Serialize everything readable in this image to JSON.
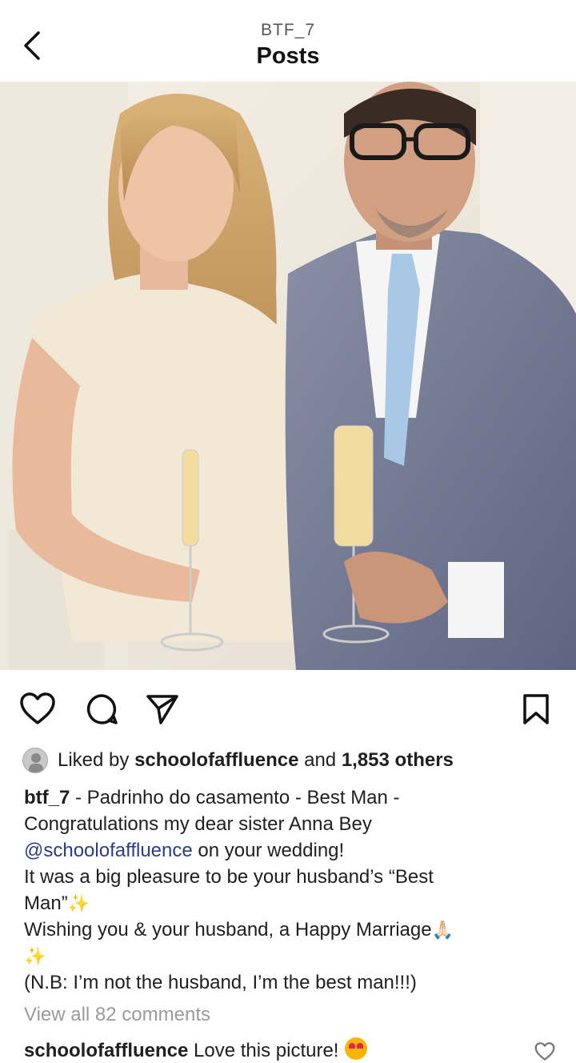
{
  "header": {
    "username": "BTF_7",
    "title": "Posts",
    "back_icon": "chevron-left-icon"
  },
  "post": {
    "image_description_icon": "photo",
    "actions": {
      "like_icon": "heart-icon",
      "comment_icon": "comment-icon",
      "share_icon": "paper-plane-icon",
      "save_icon": "bookmark-icon"
    },
    "likes": {
      "prefix": "Liked by",
      "user": "schoolofaffluence",
      "middle": "and",
      "others": "1,853 others"
    },
    "caption": {
      "author": "btf_7",
      "line1": " - Padrinho do casamento - Best Man -",
      "line2": "Congratulations my dear sister Anna Bey",
      "mention": "@schoolofaffluence",
      "line3_rest": " on your wedding!",
      "line4": "It was a big pleasure to be your husband’s “Best",
      "line5": "Man”",
      "line6": "Wishing you & your husband, a Happy Marriage",
      "line8": "(N.B: I’m not the husband, I’m the best man!!!)",
      "sparkle": "✨",
      "pray": "🙏🏻"
    },
    "view_all_comments": "View all 82 comments",
    "top_comment": {
      "user": "schoolofaffluence",
      "text": "Love this picture!"
    }
  },
  "colors": {
    "mention": "#2a3c8a",
    "muted": "#9a9a9a",
    "text": "#1f1f1f"
  }
}
